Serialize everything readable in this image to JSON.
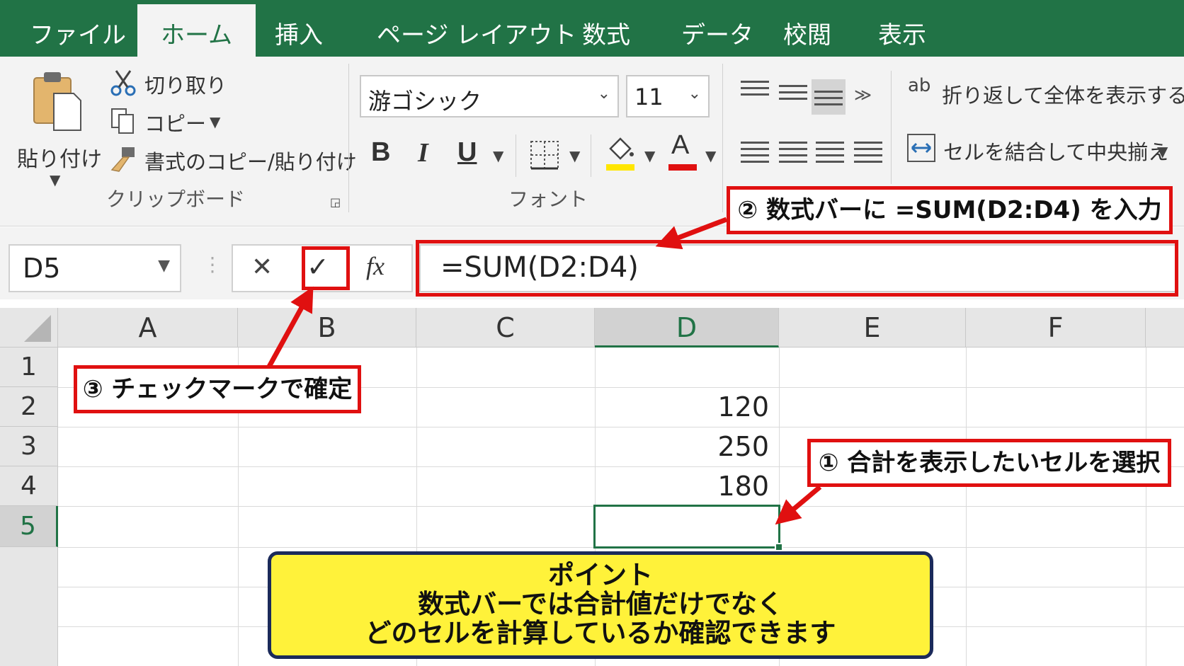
{
  "tabs": [
    {
      "label": "ファイル"
    },
    {
      "label": "ホーム"
    },
    {
      "label": "挿入"
    },
    {
      "label": "ページ レイアウト"
    },
    {
      "label": "数式"
    },
    {
      "label": "データ"
    },
    {
      "label": "校閲"
    },
    {
      "label": "表示"
    }
  ],
  "clipboard": {
    "paste_label": "貼り付け",
    "cut_label": "切り取り",
    "copy_label": "コピー",
    "format_painter_label": "書式のコピー/貼り付け",
    "group_label": "クリップボード"
  },
  "font": {
    "font_name": "游ゴシック",
    "font_size": "11",
    "bold_label": "B",
    "italic_label": "I",
    "underline_label": "U",
    "fill_color": "#ffe600",
    "font_color": "#e01010",
    "font_color_label": "A",
    "group_label": "フォント"
  },
  "alignment": {
    "wrap_icon_label": "ab",
    "wrap_label": "折り返して全体を表示する",
    "merge_label": "セルを結合して中央揃え"
  },
  "formula_bar": {
    "name_box": "D5",
    "cancel_glyph": "✕",
    "enter_glyph": "✓",
    "fx_label": "fx",
    "formula": "=SUM(D2:D4)"
  },
  "sheet": {
    "columns": [
      "A",
      "B",
      "C",
      "D",
      "E",
      "F"
    ],
    "rows": [
      "1",
      "2",
      "3",
      "4",
      "5"
    ],
    "values": {
      "D2": "120",
      "D3": "250",
      "D4": "180"
    },
    "selected_cell": "D5"
  },
  "callouts": {
    "step1": "① 合計を表示したいセルを選択",
    "step2": "② 数式バーに =SUM(D2:D4) を入力",
    "step3": "③ チェックマークで確定"
  },
  "point_box": {
    "line1": "ポイント",
    "line2": "数式バーでは合計値だけでなく",
    "line3": "どのセルを計算しているか確認できます"
  },
  "colors": {
    "excel_green": "#217346",
    "callout_red": "#e01010",
    "point_yellow": "#fff23a",
    "point_border": "#1b2a5a"
  }
}
